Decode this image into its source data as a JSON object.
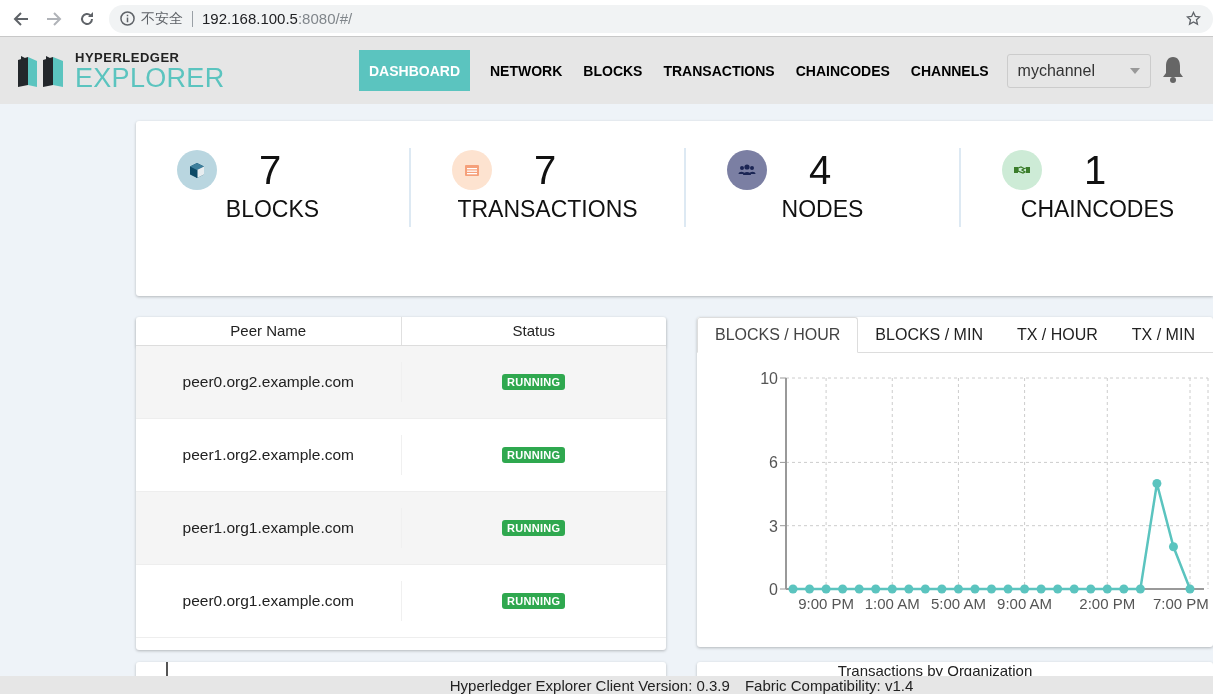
{
  "browser": {
    "security_label": "不安全",
    "url_host": "192.168.100.5",
    "url_rest": ":8080/#/"
  },
  "header": {
    "logo_top": "HYPERLEDGER",
    "logo_bottom": "EXPLORER",
    "nav": [
      {
        "label": "DASHBOARD",
        "selected": true
      },
      {
        "label": "NETWORK",
        "selected": false
      },
      {
        "label": "BLOCKS",
        "selected": false
      },
      {
        "label": "TRANSACTIONS",
        "selected": false
      },
      {
        "label": "CHAINCODES",
        "selected": false
      },
      {
        "label": "CHANNELS",
        "selected": false
      }
    ],
    "channel_select": {
      "value": "mychannel"
    }
  },
  "stats": [
    {
      "kind": "blocks",
      "count": "7",
      "label": "BLOCKS"
    },
    {
      "kind": "transactions",
      "count": "7",
      "label": "TRANSACTIONS"
    },
    {
      "kind": "nodes",
      "count": "4",
      "label": "NODES"
    },
    {
      "kind": "chaincodes",
      "count": "1",
      "label": "CHAINCODES"
    }
  ],
  "peers": {
    "columns": [
      "Peer Name",
      "Status"
    ],
    "rows": [
      {
        "name": "peer0.org2.example.com",
        "status": "RUNNING"
      },
      {
        "name": "peer1.org2.example.com",
        "status": "RUNNING"
      },
      {
        "name": "peer1.org1.example.com",
        "status": "RUNNING"
      },
      {
        "name": "peer0.org1.example.com",
        "status": "RUNNING"
      }
    ]
  },
  "chart_panel": {
    "tabs": [
      {
        "label": "BLOCKS / HOUR",
        "selected": true
      },
      {
        "label": "BLOCKS / MIN",
        "selected": false
      },
      {
        "label": "TX / HOUR",
        "selected": false
      },
      {
        "label": "TX / MIN",
        "selected": false
      }
    ],
    "chart_data": {
      "type": "line",
      "categories": [
        null,
        null,
        "9:00 PM",
        null,
        null,
        null,
        "1:00 AM",
        null,
        null,
        null,
        "5:00 AM",
        null,
        null,
        null,
        "9:00 AM",
        null,
        null,
        null,
        null,
        "2:00 PM",
        null,
        null,
        null,
        null,
        "7:00 PM"
      ],
      "series": [
        {
          "color": "#5bc4bf",
          "marker": "circle",
          "values": [
            0,
            0,
            0,
            0,
            0,
            0,
            0,
            0,
            0,
            0,
            0,
            0,
            0,
            0,
            0,
            0,
            0,
            0,
            0,
            0,
            0,
            0,
            5,
            2,
            0
          ]
        }
      ],
      "ylim": [
        0,
        10
      ],
      "yticks": [
        0,
        3,
        6,
        10
      ],
      "grid": true
    }
  },
  "bottom_panel": {
    "title": "Transactions by Organization"
  },
  "footer": {
    "version": "Hyperledger Explorer Client Version: 0.3.9",
    "compatibility": "Fabric Compatibility: v1.4"
  }
}
